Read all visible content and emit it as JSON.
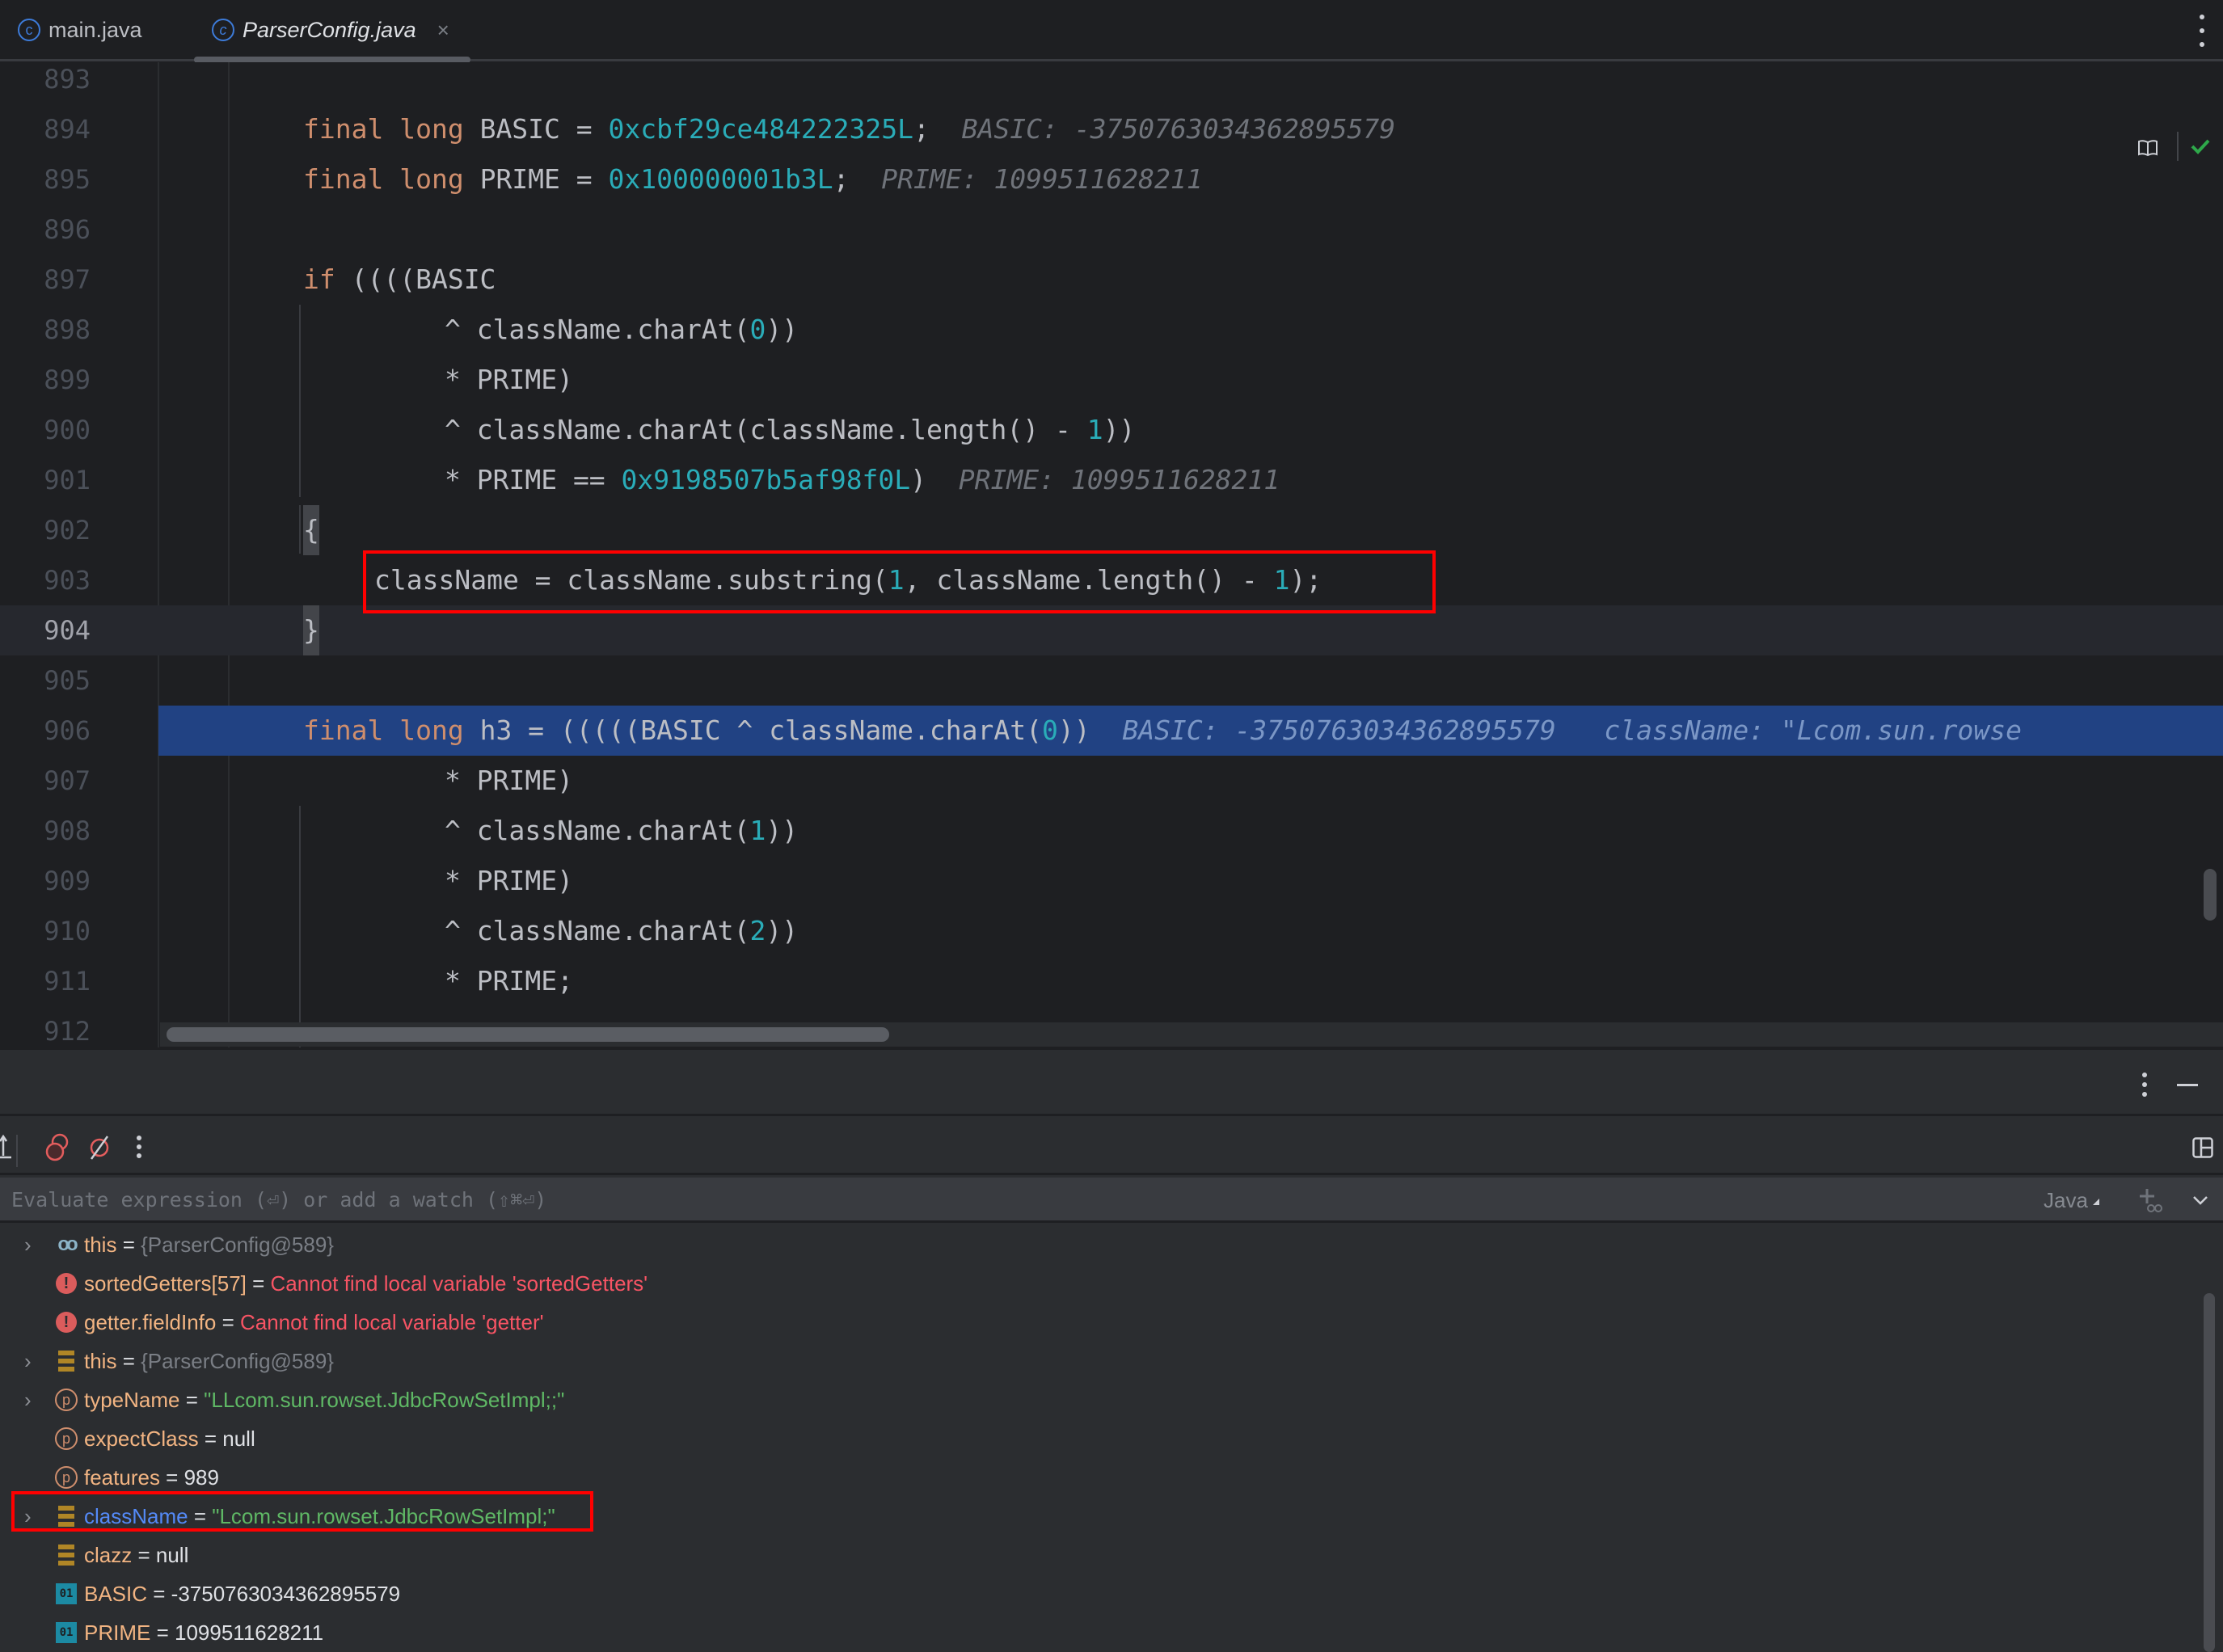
{
  "tabs": [
    {
      "label": "main.java",
      "icon": "class-icon",
      "active": false
    },
    {
      "label": "ParserConfig.java",
      "icon": "class-icon",
      "active": true,
      "closable": true
    }
  ],
  "tab_close_glyph": "×",
  "editor": {
    "current_line": 904,
    "execution_line": 906,
    "lines": [
      {
        "n": "893"
      },
      {
        "n": "894"
      },
      {
        "n": "895"
      },
      {
        "n": "896"
      },
      {
        "n": "897"
      },
      {
        "n": "898"
      },
      {
        "n": "899"
      },
      {
        "n": "900"
      },
      {
        "n": "901"
      },
      {
        "n": "902"
      },
      {
        "n": "903"
      },
      {
        "n": "904"
      },
      {
        "n": "905"
      },
      {
        "n": "906"
      },
      {
        "n": "907"
      },
      {
        "n": "908"
      },
      {
        "n": "909"
      },
      {
        "n": "910"
      },
      {
        "n": "911"
      },
      {
        "n": "912"
      }
    ],
    "code": {
      "l894": {
        "kw1": "final",
        "kw2": "long",
        "name": " BASIC = ",
        "num": "0xcbf29ce484222325L",
        "end": ";",
        "hint": "BASIC: -3750763034362895579"
      },
      "l895": {
        "kw1": "final",
        "kw2": "long",
        "name": " PRIME = ",
        "num": "0x100000001b3L",
        "end": ";",
        "hint": "PRIME: 1099511628211"
      },
      "l897": {
        "kw": "if",
        "rest": " ((((BASIC"
      },
      "l898": {
        "pre": "^ className.charAt(",
        "num": "0",
        "post": "))"
      },
      "l899": {
        "text": "* PRIME)"
      },
      "l900": {
        "pre": "^ className.charAt(className.length() - ",
        "num": "1",
        "post": "))"
      },
      "l901": {
        "pre": "* PRIME == ",
        "num": "0x9198507b5af98f0L",
        "post": ")",
        "hint": "PRIME: 1099511628211"
      },
      "l902": {
        "text": "{"
      },
      "l903": {
        "pre": "className = className.substring(",
        "num1": "1",
        "mid": ", className.length() - ",
        "num2": "1",
        "post": ");"
      },
      "l904": {
        "text": "}"
      },
      "l906": {
        "kw1": "final",
        "kw2": "long",
        "pre": " h3 = (((((BASIC ^ className.charAt(",
        "num": "0",
        "post": "))",
        "hint1": "BASIC: -3750763034362895579",
        "hint2": "className: \"Lcom.sun.rowse"
      },
      "l907": {
        "text": "* PRIME)"
      },
      "l908": {
        "pre": "^ className.charAt(",
        "num": "1",
        "post": "))"
      },
      "l909": {
        "text": "* PRIME)"
      },
      "l910": {
        "pre": "^ className.charAt(",
        "num": "2",
        "post": "))"
      },
      "l911": {
        "text": "* PRIME;"
      }
    }
  },
  "debug": {
    "eval_placeholder": "Evaluate expression (⏎) or add a watch (⇧⌘⏎)",
    "language": "Java",
    "variables": [
      {
        "icon": "watch-icon",
        "expandable": true,
        "name": "this",
        "value": "{ParserConfig@589}",
        "kind": "obj"
      },
      {
        "icon": "error-icon",
        "expandable": false,
        "name": "sortedGetters[57]",
        "value": "Cannot find local variable 'sortedGetters'",
        "kind": "err"
      },
      {
        "icon": "error-icon",
        "expandable": false,
        "name": "getter.fieldInfo",
        "value": "Cannot find local variable 'getter'",
        "kind": "err"
      },
      {
        "icon": "field-icon",
        "expandable": true,
        "name": "this",
        "value": "{ParserConfig@589}",
        "kind": "obj"
      },
      {
        "icon": "parameter-icon",
        "expandable": true,
        "name": "typeName",
        "value": "\"LLcom.sun.rowset.JdbcRowSetImpl;;\"",
        "kind": "str"
      },
      {
        "icon": "parameter-icon",
        "expandable": false,
        "name": "expectClass",
        "value": "null",
        "kind": "plain"
      },
      {
        "icon": "parameter-icon",
        "expandable": false,
        "name": "features",
        "value": "989",
        "kind": "plain"
      },
      {
        "icon": "field-icon",
        "expandable": true,
        "name": "className",
        "value": "\"Lcom.sun.rowset.JdbcRowSetImpl;\"",
        "kind": "str",
        "changed": true,
        "highlighted": true
      },
      {
        "icon": "field-icon",
        "expandable": false,
        "name": "clazz",
        "value": "null",
        "kind": "plain"
      },
      {
        "icon": "primitive-icon",
        "expandable": false,
        "name": "BASIC",
        "value": "-3750763034362895579",
        "kind": "plain"
      },
      {
        "icon": "primitive-icon",
        "expandable": false,
        "name": "PRIME",
        "value": "1099511628211",
        "kind": "plain"
      }
    ],
    "eq": " = ",
    "icon_glyphs": {
      "class": "c",
      "param": "p",
      "error": "!",
      "prim": "01",
      "chevron": "›"
    }
  },
  "colors": {
    "keyword": "#cf8e6d",
    "number": "#2aacb8",
    "execution_line": "#214283",
    "annotation_box": "#ff0000",
    "string_value": "#5fb865",
    "error_value": "#f75464",
    "variable_name": "#f2b482"
  }
}
